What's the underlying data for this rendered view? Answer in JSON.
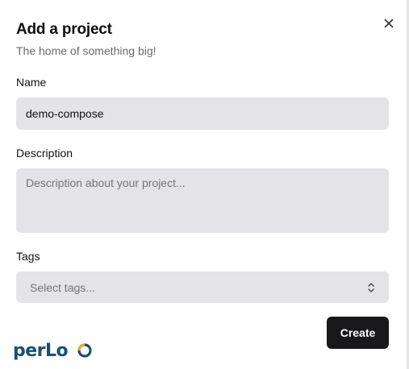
{
  "dialog": {
    "title": "Add a project",
    "subtitle": "The home of something big!",
    "close_icon": "close-icon"
  },
  "form": {
    "name": {
      "label": "Name",
      "value": "demo-compose"
    },
    "description": {
      "label": "Description",
      "value": "",
      "placeholder": "Description about your project..."
    },
    "tags": {
      "label": "Tags",
      "placeholder": "Select tags...",
      "icon": "chevron-up-down-icon"
    }
  },
  "actions": {
    "create_label": "Create"
  },
  "brand": {
    "logo_text": "perLoo",
    "primary_color": "#1a4f72",
    "accent_color": "#f5a623"
  },
  "colors": {
    "field_bg": "#e4e4e7",
    "button_bg": "#18181b",
    "button_text": "#ffffff"
  }
}
